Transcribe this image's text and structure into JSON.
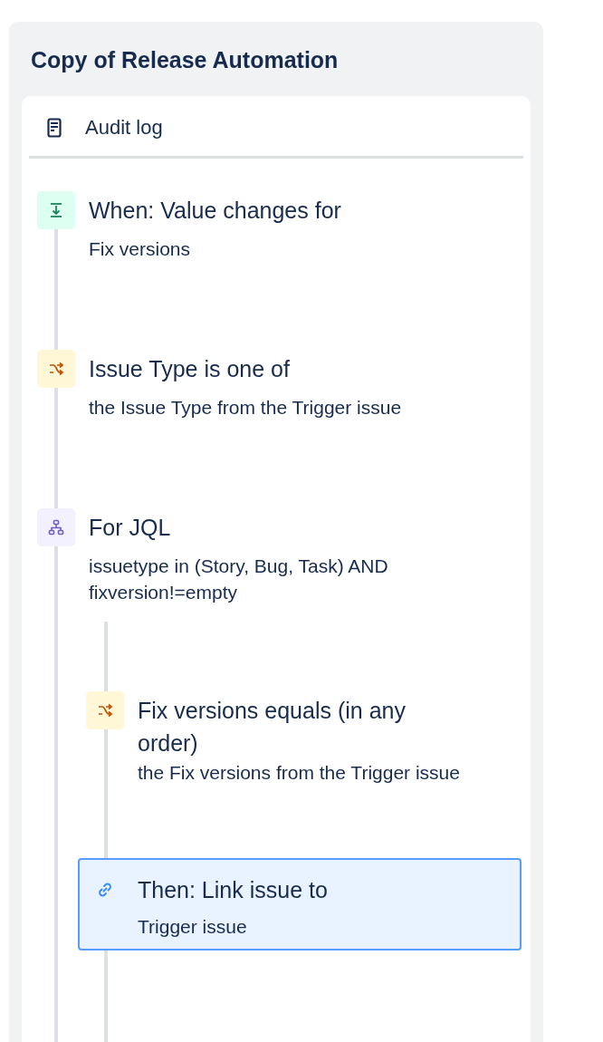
{
  "panel": {
    "title": "Copy of Release Automation"
  },
  "audit_log": {
    "label": "Audit log"
  },
  "steps": [
    {
      "kind": "trigger",
      "title": "When: Value changes for",
      "detail": "Fix versions",
      "selected": false
    },
    {
      "kind": "condition",
      "title": "Issue Type is one of",
      "detail": "the Issue Type from the Trigger issue",
      "selected": false
    },
    {
      "kind": "branch",
      "title": "For JQL",
      "detail": "issuetype in (Story, Bug, Task) AND fixversion!=empty",
      "selected": false,
      "children": [
        {
          "kind": "condition",
          "title": "Fix versions equals (in any order)",
          "detail": "the Fix versions from the Trigger issue",
          "selected": false
        },
        {
          "kind": "action",
          "title": "Then: Link issue to",
          "detail": "Trigger issue",
          "selected": true
        }
      ]
    }
  ]
}
